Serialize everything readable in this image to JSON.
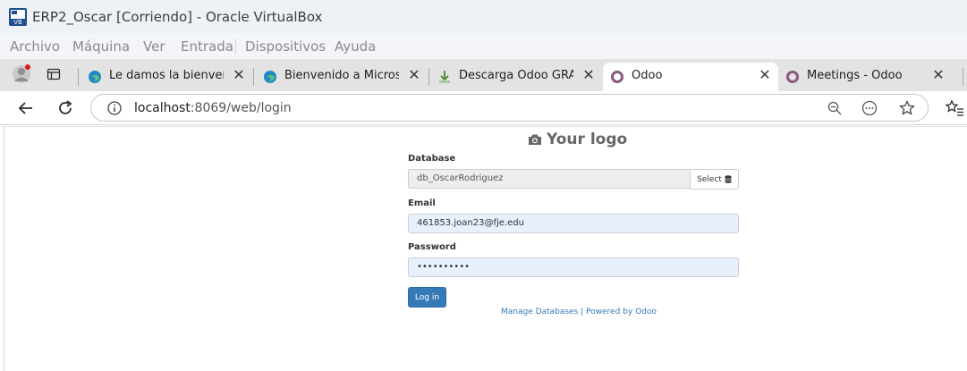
{
  "window": {
    "title": "ERP2_Oscar [Corriendo] - Oracle VirtualBox",
    "menu": [
      "Archivo",
      "Máquina",
      "Ver",
      "Entrada",
      "Dispositivos",
      "Ayuda"
    ]
  },
  "browser": {
    "tabs": [
      {
        "label": "Le damos la bienvenida",
        "favicon": "edge-icon",
        "active": false
      },
      {
        "label": "Bienvenido a Microsoft Ed",
        "favicon": "edge-icon",
        "active": false
      },
      {
        "label": "Descarga Odoo GRATIS - T",
        "favicon": "download-icon",
        "active": false
      },
      {
        "label": "Odoo",
        "favicon": "odoo-icon",
        "active": true
      },
      {
        "label": "Meetings - Odoo",
        "favicon": "odoo-icon",
        "active": false
      }
    ],
    "url": {
      "host": "localhost",
      "path": ":8069/web/login"
    }
  },
  "page": {
    "logo_text": "Your logo",
    "database": {
      "label": "Database",
      "value": "db_OscarRodriguez",
      "select_label": "Select"
    },
    "email": {
      "label": "Email",
      "value": "461853.joan23@fje.edu"
    },
    "password": {
      "label": "Password",
      "value": "••••••••••"
    },
    "login_label": "Log in",
    "footer": {
      "manage": "Manage Databases",
      "separator": "|",
      "powered": "Powered by Odoo"
    }
  },
  "colors": {
    "odoo_primary": "#337ab7",
    "autofill_bg": "#e8f0fe",
    "odoo_purple": "#875a7b"
  }
}
